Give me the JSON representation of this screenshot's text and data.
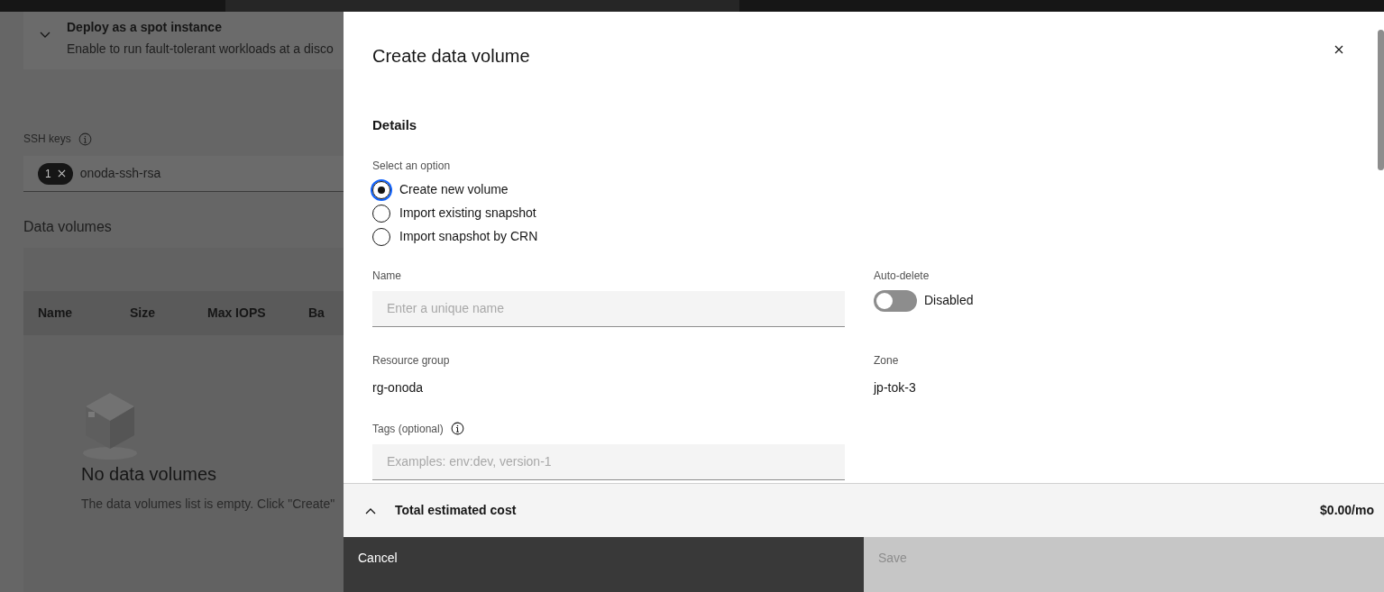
{
  "background_page": {
    "spot_instance": {
      "title": "Deploy as a spot instance",
      "description": "Enable to run fault-tolerant workloads at a disco"
    },
    "ssh_keys": {
      "label": "SSH keys",
      "tag_count": "1",
      "value": "onoda-ssh-rsa"
    },
    "data_volumes": {
      "title": "Data volumes",
      "columns": [
        "Name",
        "Size",
        "Max IOPS",
        "Ba"
      ],
      "empty_title": "No data volumes",
      "empty_text": "The data volumes list is empty. Click \"Create\""
    }
  },
  "modal": {
    "title": "Create data volume",
    "section": "Details",
    "option_label": "Select an option",
    "options": [
      {
        "label": "Create new volume",
        "selected": true
      },
      {
        "label": "Import existing snapshot",
        "selected": false
      },
      {
        "label": "Import snapshot by CRN",
        "selected": false
      }
    ],
    "name": {
      "label": "Name",
      "placeholder": "Enter a unique name"
    },
    "auto_delete": {
      "label": "Auto-delete",
      "on": false,
      "state_text": "Disabled"
    },
    "resource_group": {
      "label": "Resource group",
      "value": "rg-onoda"
    },
    "zone": {
      "label": "Zone",
      "value": "jp-tok-3"
    },
    "tags": {
      "label": "Tags (optional)",
      "placeholder": "Examples: env:dev, version-1"
    },
    "cost": {
      "label": "Total estimated cost",
      "value": "$0.00/mo"
    },
    "buttons": [
      {
        "label": "Cancel",
        "disabled": false
      },
      {
        "label": "Save",
        "disabled": true
      }
    ]
  }
}
